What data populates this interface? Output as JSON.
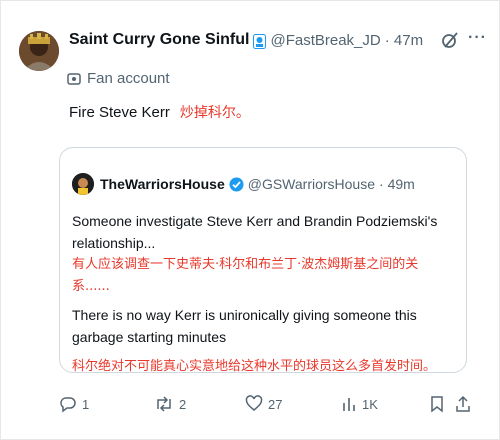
{
  "tweet": {
    "author_name": "Saint Curry Gone Sinful",
    "author_handle": "@FastBreak_JD",
    "time": "· 47m",
    "label": "Fan account",
    "text": "Fire Steve Kerr",
    "translation": "炒掉科尔。"
  },
  "quote": {
    "author_name": "TheWarriorsHouse",
    "author_handle": "@GSWarriorsHouse",
    "time": "· 49m",
    "line1": "Someone investigate Steve Kerr and Brandin Podziemski's relationship...",
    "line1_zh": "有人应该调查一下史蒂夫·科尔和布兰丁·波杰姆斯基之间的关系......",
    "line2": "There is no way Kerr is unironically giving someone this garbage starting minutes",
    "line2_zh": "科尔绝对不可能真心实意地给这种水平的球员这么多首发时间。"
  },
  "actions": {
    "replies": "1",
    "reposts": "2",
    "likes": "27",
    "views": "1K"
  },
  "colors": {
    "accent": "#1d9bf0",
    "muted": "#536471",
    "translation": "#e8382b"
  },
  "icons": [
    "grok-icon",
    "more-icon",
    "fan-account-icon",
    "verified-badge-icon",
    "reply-icon",
    "repost-icon",
    "like-icon",
    "views-icon",
    "bookmark-icon",
    "share-icon"
  ]
}
